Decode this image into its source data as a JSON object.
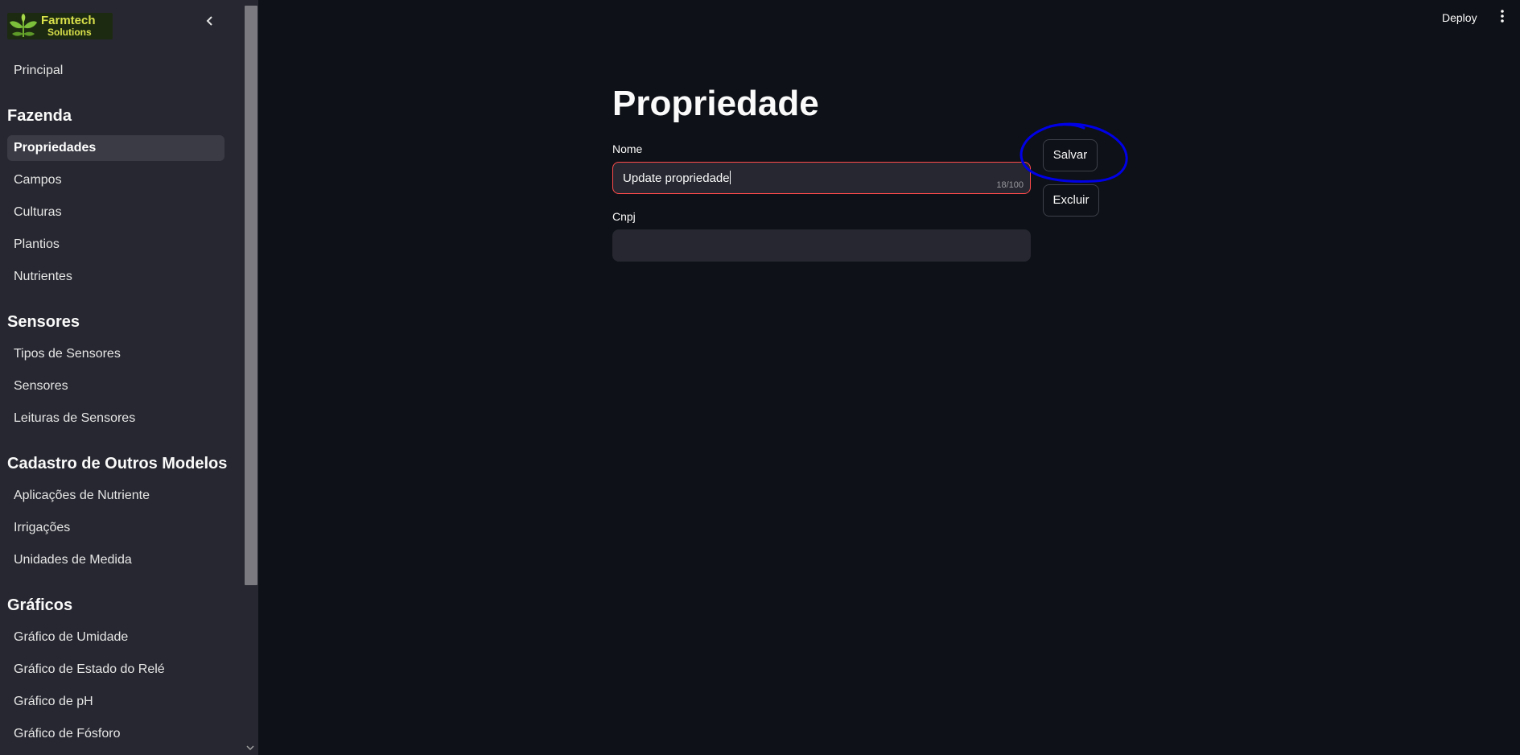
{
  "sidebar": {
    "logo": {
      "line1": "Farmtech",
      "line2": "Solutions"
    },
    "collapse_icon": "chevron-left-icon",
    "principal": "Principal",
    "sections": {
      "fazenda": {
        "title": "Fazenda",
        "items": [
          "Propriedades",
          "Campos",
          "Culturas",
          "Plantios",
          "Nutrientes"
        ],
        "active": "Propriedades"
      },
      "sensores": {
        "title": "Sensores",
        "items": [
          "Tipos de Sensores",
          "Sensores",
          "Leituras de Sensores"
        ]
      },
      "cadastro": {
        "title": "Cadastro de Outros Modelos",
        "items": [
          "Aplicações de Nutriente",
          "Irrigações",
          "Unidades de Medida"
        ]
      },
      "graficos": {
        "title": "Gráficos",
        "items": [
          "Gráfico de Umidade",
          "Gráfico de Estado do Relé",
          "Gráfico de pH",
          "Gráfico de Fósforo"
        ]
      }
    }
  },
  "header": {
    "deploy_label": "Deploy",
    "menu_icon": "kebab-menu-icon"
  },
  "main": {
    "title": "Propriedade",
    "nome": {
      "label": "Nome",
      "value": "Update propriedade",
      "counter": "18/100"
    },
    "cnpj": {
      "label": "Cnpj",
      "value": ""
    },
    "buttons": {
      "save": "Salvar",
      "delete": "Excluir"
    }
  },
  "colors": {
    "accent_border": "#ff4b4b",
    "annotation": "#0000e6",
    "background": "#0e1117",
    "sidebar": "#262730"
  }
}
